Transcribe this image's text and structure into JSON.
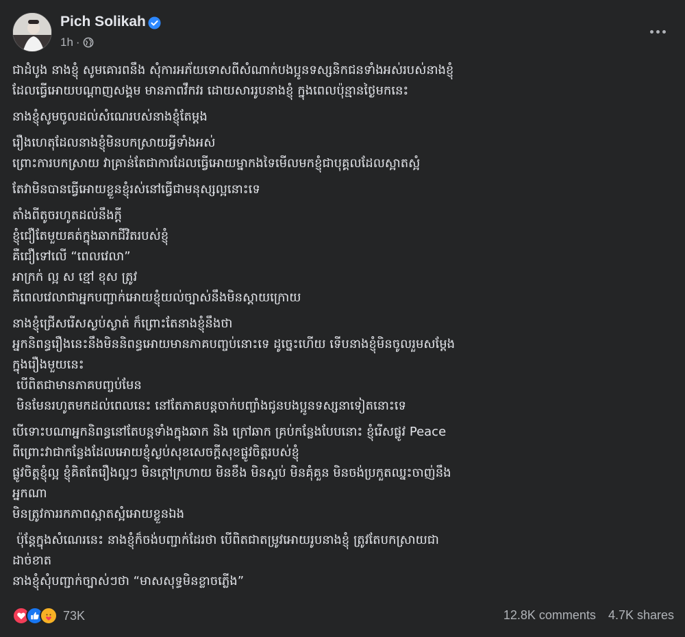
{
  "author": {
    "name": "Pich Solikah",
    "time": "1h",
    "separator": "·",
    "verified_icon": "verified-badge-icon",
    "privacy_icon": "globe-icon",
    "verified_color": "#2d88ff"
  },
  "menu": {
    "icon": "more-horizontal-icon"
  },
  "body": {
    "paragraphs": [
      [
        "ជាដំបូង នាងខ្ញុំ សូមគោរពនឹង សុំការអភ័យទោសពីសំណាក់បងប្អូនទស្សនិកជនទាំងអស់របស់នាងខ្ញុំ",
        "ដែលធ្វើអោយបណ្ដាញសង្គម មានភាពវឹកវរ ដោយសាររូបនាងខ្ញុំ ក្នុងពេលប៉ុន្មានថ្ងៃមកនេះ"
      ],
      [
        "នាងខ្ញុំសូមចូលដល់សំណេរបស់នាងខ្ញុំតែម្ដង"
      ],
      [
        "រឿងហេតុដែលនាងខ្ញុំមិនបកស្រាយអ្វីទាំងអស់",
        "ព្រោះការបកស្រាយ វាគ្រាន់តែជាការដែលធ្វើអោយម្នាកងទៃមើលមកខ្ញុំជាបុគ្គលដែលស្អាតស្អំ"
      ],
      [
        "តែវាមិនបានធ្វើអោយខ្លួនខ្ញុំរស់នៅធ្វើជាមនុស្សល្អនោះទេ"
      ],
      [
        "តាំងពីតូចរហូតដល់នឹងក្ដី",
        "ខ្ញុំជឿតែមួយគត់ក្នុងឆាកជីវិតរបស់ខ្ញុំ",
        "គឺជឿទៅលើ “ពេលវេលា”",
        "អាក្រក់ ល្អ ស ខ្មៅ ខុស ត្រូវ",
        "គឺពេលវេលាជាអ្នកបញ្ជាក់អោយខ្ញុំយល់ច្បាស់នឹងមិនស្ដាយក្រោយ"
      ],
      [
        "នាងខ្ញុំជ្រើសរើសស្ងប់ស្ងាត់ ក៏ព្រោះតែនាងខ្ញុំនឹងថា",
        "អ្នកនិពន្ធរឿងនេះនឹងមិននិពន្ធអោយមានភាគបញ្ចប់នោះទេ ដូច្នេះហើយ ទើបនាងខ្ញុំមិនចូលរួមសម្ដែង",
        "ក្នុងរឿងមួយនេះ",
        " បើពិតជាមានភាគបញ្ចប់មែន",
        " មិនមែនរហូតមកដល់ពេលនេះ នៅតែភាគបន្តចាក់បញ្ចាំងជូនបងប្អូនទស្សនាទៀតនោះទេ"
      ],
      [
        "បើទោះបណាអ្នកនិពន្ធនៅតែបន្តទាំងក្នុងឆាក និង ក្រៅឆាក គ្រប់កន្លែងបែបនោះ ខ្ញុំរើសផ្លូវ Peace",
        "ពីព្រោះវាជាកន្លែងដែលអោយខ្ញុំស្ងប់សុខសេចក្ដីសុខផ្លូវចិត្តរបស់ខ្ញុំ",
        "ផ្លូវចិត្តខ្ញុំល្អ ខ្ញុំគិតតែរឿងល្អៗ  មិនក្ដៅក្រហាយ មិនខឹង មិនស្អប់ មិនគុំគួន មិនចង់ប្រកួតឈ្នះចាញ់នឹង",
        "អ្នកណា",
        "មិនត្រូវការរកភាពស្អាតស្អំអោយខ្លួនឯង"
      ],
      [
        " ប៉ុន្តែក្នុងសំណេរនេះ នាងខ្ញុំក៏ចង់បញ្ជាក់ដែរថា បើពិតជាតម្រូវអោយរូបនាងខ្ញុំ ត្រូវតែបកស្រាយជា",
        "ដាច់ខាត",
        "នាងខ្ញុំសុំបញ្ជាក់ច្បាស់ៗថា “មាសសុទ្ធមិនខ្លាចភ្លើង”"
      ]
    ]
  },
  "footer": {
    "reaction_icons": [
      "love-reaction-icon",
      "like-reaction-icon",
      "care-reaction-icon"
    ],
    "reaction_count": "73K",
    "comments": "12.8K comments",
    "shares": "4.7K shares"
  }
}
